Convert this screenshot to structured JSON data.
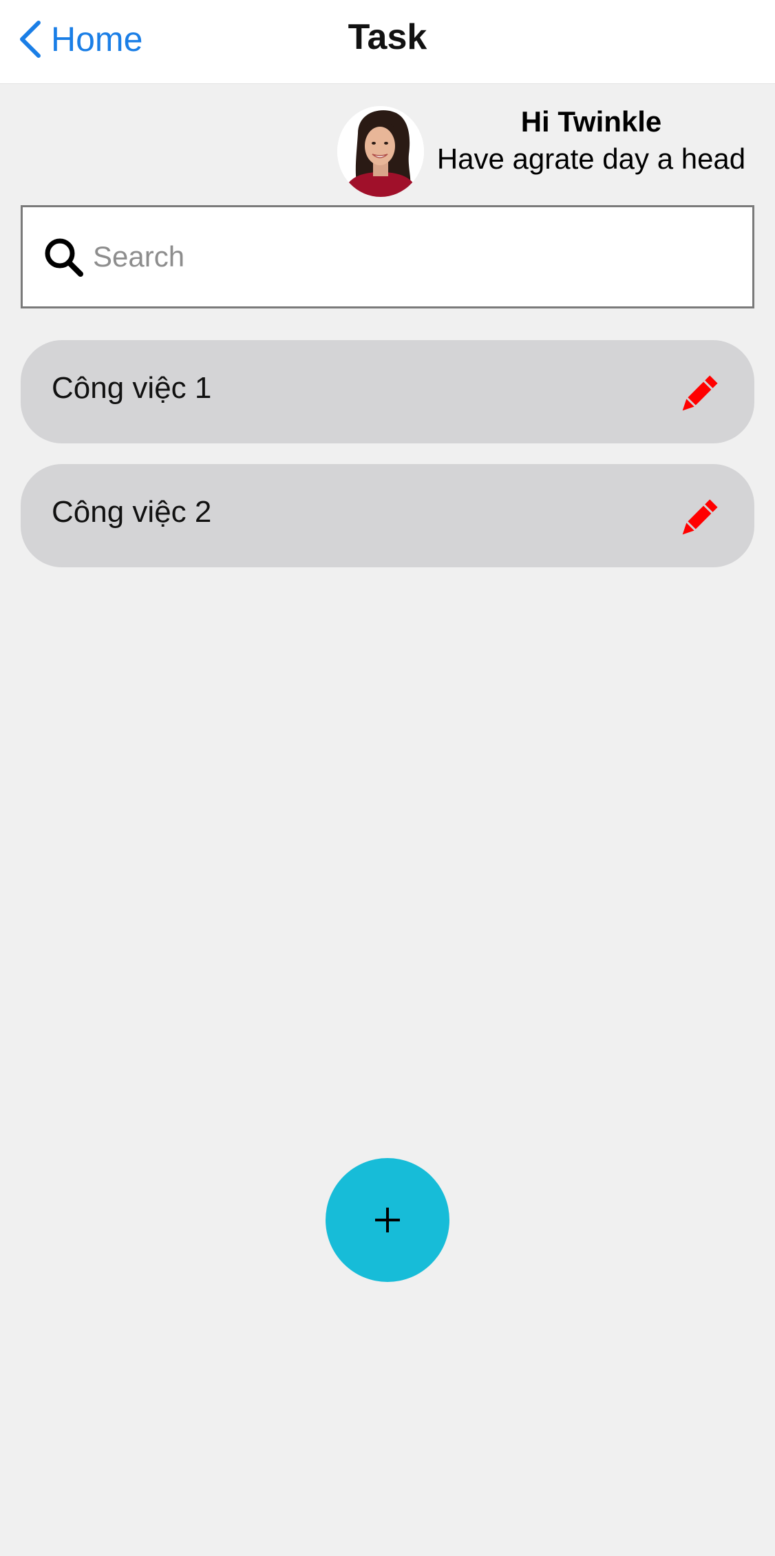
{
  "nav": {
    "back_label": "Home",
    "title": "Task"
  },
  "greeting": {
    "name": "Hi Twinkle",
    "message": "Have agrate day a head"
  },
  "search": {
    "placeholder": "Search",
    "value": ""
  },
  "tasks": [
    {
      "label": "Công việc 1"
    },
    {
      "label": "Công việc 2"
    }
  ],
  "colors": {
    "accent": "#1a7ee6",
    "fab": "#17bcd8",
    "edit_icon": "#ff0000",
    "task_bg": "#d4d4d6"
  },
  "icons": {
    "back": "chevron-left-icon",
    "search": "search-icon",
    "edit": "pencil-icon",
    "add": "plus-icon"
  }
}
